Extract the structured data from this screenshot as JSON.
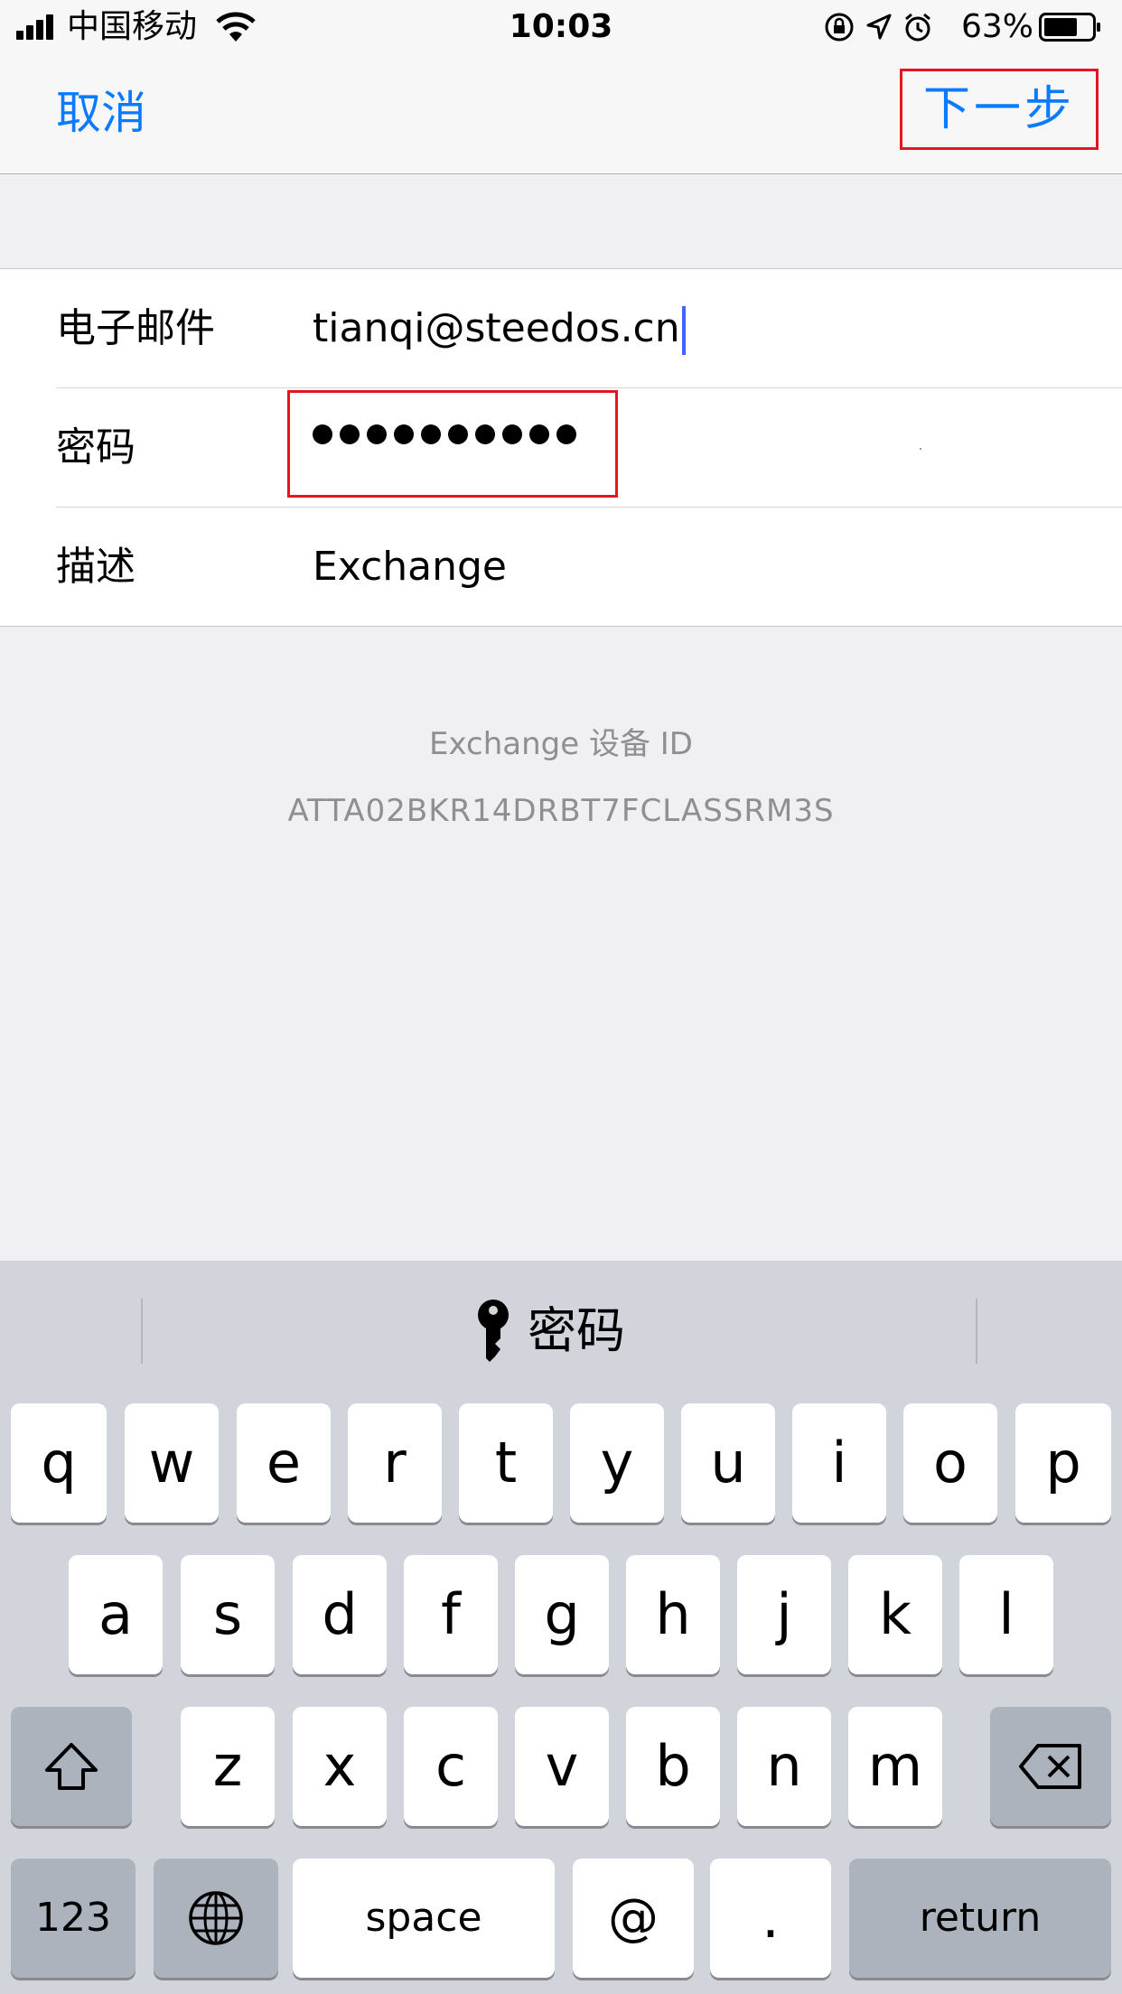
{
  "status_bar": {
    "carrier": "中国移动",
    "time": "10:03",
    "battery": "63%"
  },
  "nav": {
    "cancel": "取消",
    "next": "下一步"
  },
  "form": {
    "rows": [
      {
        "label": "电子邮件",
        "value": "tianqi@steedos.cn"
      },
      {
        "label": "密码",
        "value": "••••••••••"
      },
      {
        "label": "描述",
        "value": "Exchange"
      }
    ]
  },
  "device": {
    "title": "Exchange 设备 ID",
    "id": "ATTA02BKR14DRBT7FCLASSRM3S"
  },
  "keyboard": {
    "suggestion": "密码",
    "row1": [
      "q",
      "w",
      "e",
      "r",
      "t",
      "y",
      "u",
      "i",
      "o",
      "p"
    ],
    "row2": [
      "a",
      "s",
      "d",
      "f",
      "g",
      "h",
      "j",
      "k",
      "l"
    ],
    "row3": [
      "z",
      "x",
      "c",
      "v",
      "b",
      "n",
      "m"
    ],
    "numbers": "123",
    "space": "space",
    "at": "@",
    "dot": ".",
    "return": "return"
  },
  "colors": {
    "accent": "#0a7aff",
    "highlight_box": "#e5141f",
    "caret": "#3e66ff"
  }
}
